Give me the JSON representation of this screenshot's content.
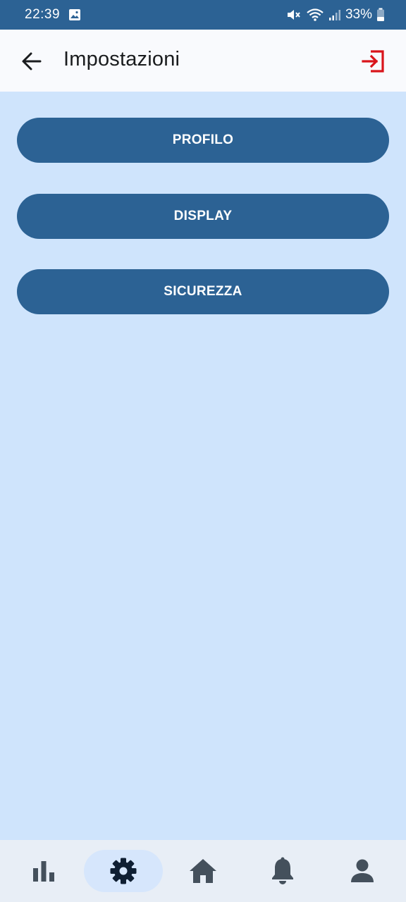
{
  "status_bar": {
    "time": "22:39",
    "battery": "33%",
    "icons": [
      "gallery-icon",
      "mute-icon",
      "wifi-icon",
      "signal-icon",
      "battery-icon"
    ]
  },
  "app_bar": {
    "title": "Impostazioni",
    "back_icon": "arrow-back-icon",
    "logout_icon": "logout-icon",
    "logout_color": "#d9141b"
  },
  "menu": {
    "buttons": [
      {
        "label": "PROFILO"
      },
      {
        "label": "DISPLAY"
      },
      {
        "label": "SICUREZZA"
      }
    ]
  },
  "bottom_nav": {
    "items": [
      {
        "icon": "bar-chart-icon",
        "active": false
      },
      {
        "icon": "gear-icon",
        "active": true
      },
      {
        "icon": "home-icon",
        "active": false
      },
      {
        "icon": "bell-icon",
        "active": false
      },
      {
        "icon": "person-icon",
        "active": false
      }
    ]
  },
  "colors": {
    "primary": "#2c6294",
    "background": "#cfe4fc",
    "app_bar_bg": "#f9fafd",
    "nav_bg": "#e8eef6",
    "nav_active_pill": "#d6e6fc",
    "icon_dark": "#44505c"
  }
}
